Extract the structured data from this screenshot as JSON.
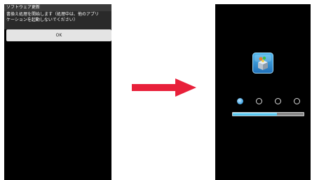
{
  "left_screen": {
    "dialog_title": "ソフトウェア更新",
    "message_line1": "書換え処理を開始します（処理中は、他のアプリ",
    "message_line2": "ケーションを起動しないでください）",
    "ok_label": "OK"
  },
  "arrow": {
    "icon": "arrow-right-icon",
    "color": "#e8203a"
  },
  "right_screen": {
    "icon": "software-update-icon",
    "page_indicator": {
      "total": 4,
      "active_index": 0
    },
    "progress": {
      "fraction": 0.62,
      "color": "#2fb6e8"
    }
  }
}
